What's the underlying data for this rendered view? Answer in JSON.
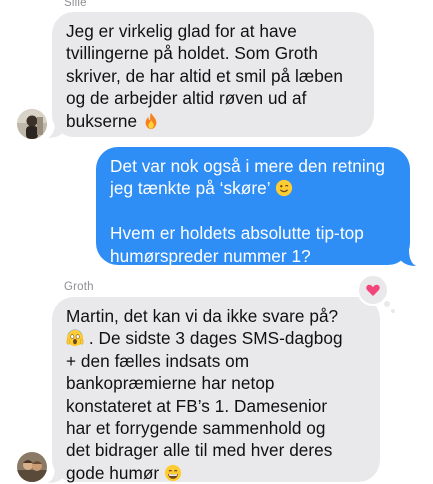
{
  "conversation": {
    "messages": [
      {
        "sender": "Sille",
        "direction": "incoming",
        "lines": [
          "Jeg er virkelig glad for at have",
          "tvillingerne på holdet. Som Groth",
          "skriver, de har altid et smil på læben",
          "og de arbejder altid røven ud af",
          "bukserne"
        ],
        "trailing_emoji": "fire-emoji"
      },
      {
        "sender": "",
        "direction": "outgoing",
        "lines": [
          "Det var nok også i mere den retning",
          "jeg tænkte på ‘skøre’"
        ],
        "lines2": [
          "Hvem er holdets absolutte tip-top",
          "humørspreder nummer 1?"
        ],
        "trailing_emoji": "winking-face-emoji"
      },
      {
        "sender": "Groth",
        "direction": "incoming",
        "lines": [
          "Martin, det kan vi da ikke svare på?",
          ". De sidste 3 dages SMS-dagbog",
          "+ den fælles indsats om",
          "bankopræmierne har netop",
          "konstateret at FB’s 1. Damesenior",
          "har et forrygende sammenhold og",
          "det bidrager alle til med hver deres",
          "gode humør"
        ],
        "leading_emoji": "screaming-face-emoji",
        "trailing_emoji": "grinning-face-emoji",
        "tapback": "heart-icon"
      }
    ]
  },
  "colors": {
    "incoming_bubble": "#e9e9eb",
    "outgoing_bubble": "#2f8ef5",
    "tapback_heart": "#f2457a",
    "sender_label": "#8e8e93"
  }
}
